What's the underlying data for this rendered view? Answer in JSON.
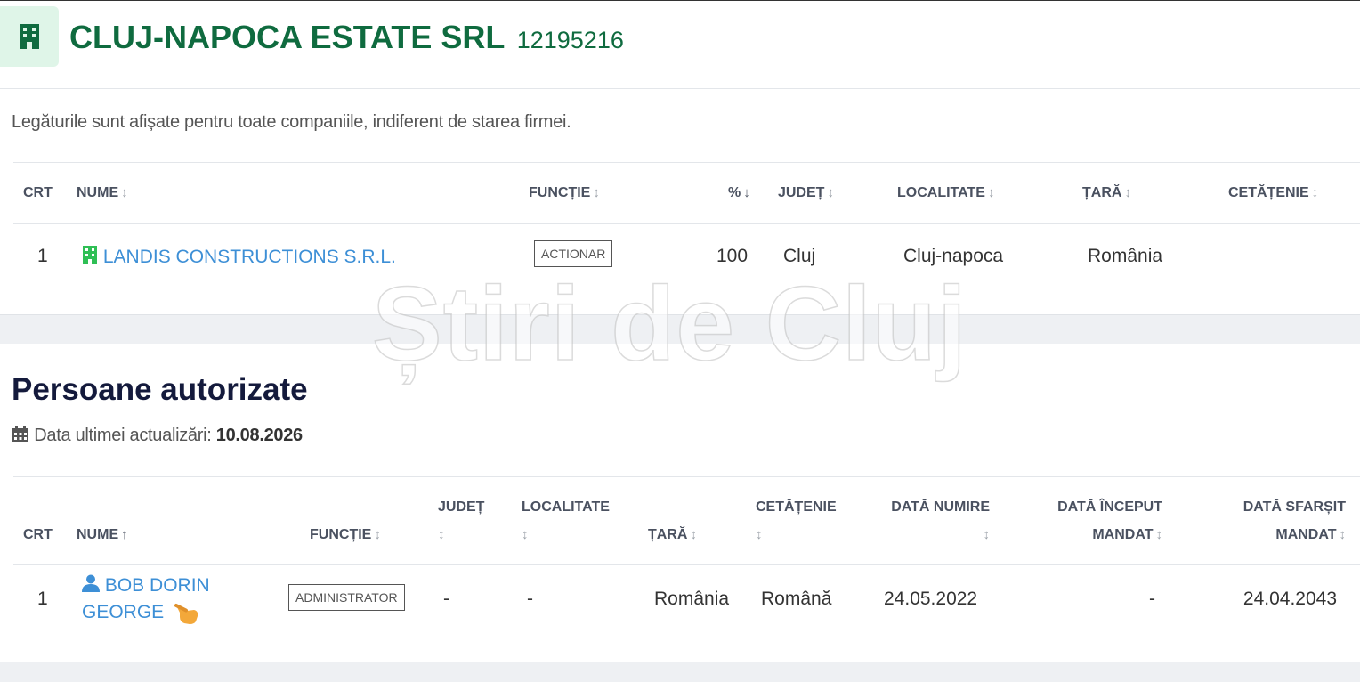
{
  "header": {
    "company_name": "CLUJ-NAPOCA ESTATE SRL",
    "company_code": "12195216",
    "icon": "building-icon"
  },
  "links_section": {
    "note": "Legăturile sunt afișate pentru toate companiile, indiferent de starea firmei.",
    "columns": {
      "crt": "CRT",
      "nume": "NUME",
      "functie": "FUNCȚIE",
      "procent": "%",
      "judet": "JUDEȚ",
      "localitate": "LOCALITATE",
      "tara": "ȚARĂ",
      "cetatenie": "CETĂȚENIE"
    },
    "rows": [
      {
        "crt": "1",
        "nume": "LANDIS CONSTRUCTIONS S.R.L.",
        "functie": "ACTIONAR",
        "procent": "100",
        "judet": "Cluj",
        "localitate": "Cluj-napoca",
        "tara": "România",
        "cetatenie": ""
      }
    ]
  },
  "authorized_section": {
    "title": "Persoane autorizate",
    "update_label": "Data ultimei actualizări:",
    "update_date": "10.08.2026",
    "columns": {
      "crt": "CRT",
      "nume": "NUME",
      "functie": "FUNCȚIE",
      "judet": "JUDEȚ",
      "localitate": "LOCALITATE",
      "tara": "ȚARĂ",
      "cetatenie": "CETĂȚENIE",
      "data_numire": "DATĂ NUMIRE",
      "data_inceput_l1": "DATĂ ÎNCEPUT",
      "data_inceput_l2": "MANDAT",
      "data_sfarsit_l1": "DATĂ SFARȘIT",
      "data_sfarsit_l2": "MANDAT"
    },
    "rows": [
      {
        "crt": "1",
        "nume_line1": "BOB DORIN",
        "nume_line2": "GEORGE",
        "functie": "ADMINISTRATOR",
        "judet": "-",
        "localitate": "-",
        "tara": "România",
        "cetatenie": "Română",
        "data_numire": "24.05.2022",
        "data_inceput_mandat": "-",
        "data_sfarsit_mandat": "24.04.2043"
      }
    ]
  },
  "watermark": "Știri de Cluj",
  "colors": {
    "brand_green": "#0f6b3f",
    "link_blue": "#3d8fd6",
    "icon_green": "#2fbf55",
    "title_navy": "#141a3c",
    "hand_orange": "#f3a83a"
  }
}
